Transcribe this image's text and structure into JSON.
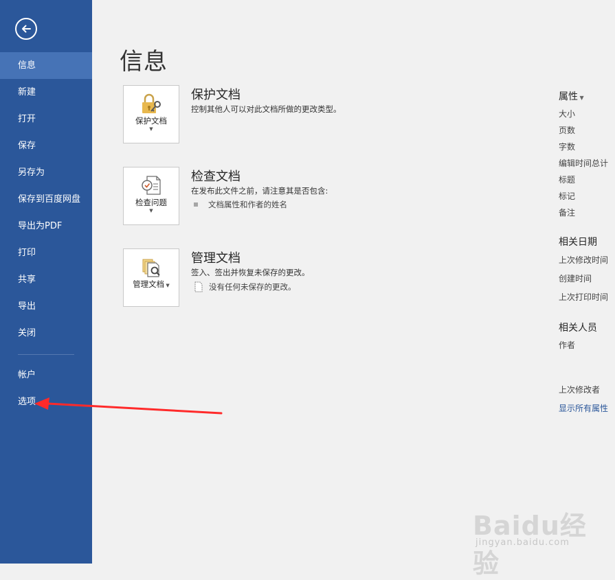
{
  "sidebar": {
    "items": [
      {
        "label": "信息",
        "active": true
      },
      {
        "label": "新建"
      },
      {
        "label": "打开"
      },
      {
        "label": "保存"
      },
      {
        "label": "另存为"
      },
      {
        "label": "保存到百度网盘"
      },
      {
        "label": "导出为PDF"
      },
      {
        "label": "打印"
      },
      {
        "label": "共享"
      },
      {
        "label": "导出"
      },
      {
        "label": "关闭"
      }
    ],
    "bottom_items": [
      {
        "label": "帐户"
      },
      {
        "label": "选项"
      }
    ],
    "back_icon": "back-arrow-icon",
    "color": "#2b579a",
    "active_color": "#4673b6"
  },
  "page": {
    "title": "信息"
  },
  "sections": [
    {
      "tile_label": "保护文档",
      "tile_icon": "lock-key-icon",
      "title": "保护文档",
      "description": "控制其他人可以对此文档所做的更改类型。"
    },
    {
      "tile_label": "检查问题",
      "tile_icon": "inspect-document-icon",
      "title": "检查文档",
      "description": "在发布此文件之前，请注意其是否包含:",
      "bullet": "文档属性和作者的姓名"
    },
    {
      "tile_label": "管理文档",
      "tile_icon": "manage-document-icon",
      "title": "管理文档",
      "description": "签入、签出并恢复未保存的更改。",
      "bullet": "没有任何未保存的更改。"
    }
  ],
  "properties": {
    "header": "属性",
    "items": [
      "大小",
      "页数",
      "字数",
      "编辑时间总计",
      "标题",
      "标记",
      "备注"
    ],
    "related_dates": {
      "header": "相关日期",
      "items": [
        "上次修改时间",
        "创建时间",
        "上次打印时间"
      ]
    },
    "related_people": {
      "header": "相关人员",
      "items": [
        "作者"
      ]
    },
    "last_modified_by": "上次修改者",
    "show_all_link": "显示所有属性"
  },
  "annotation": {
    "color": "#ff2a2a"
  },
  "watermark": {
    "text": "Baidu经验",
    "sub": "jingyan.baidu.com"
  }
}
